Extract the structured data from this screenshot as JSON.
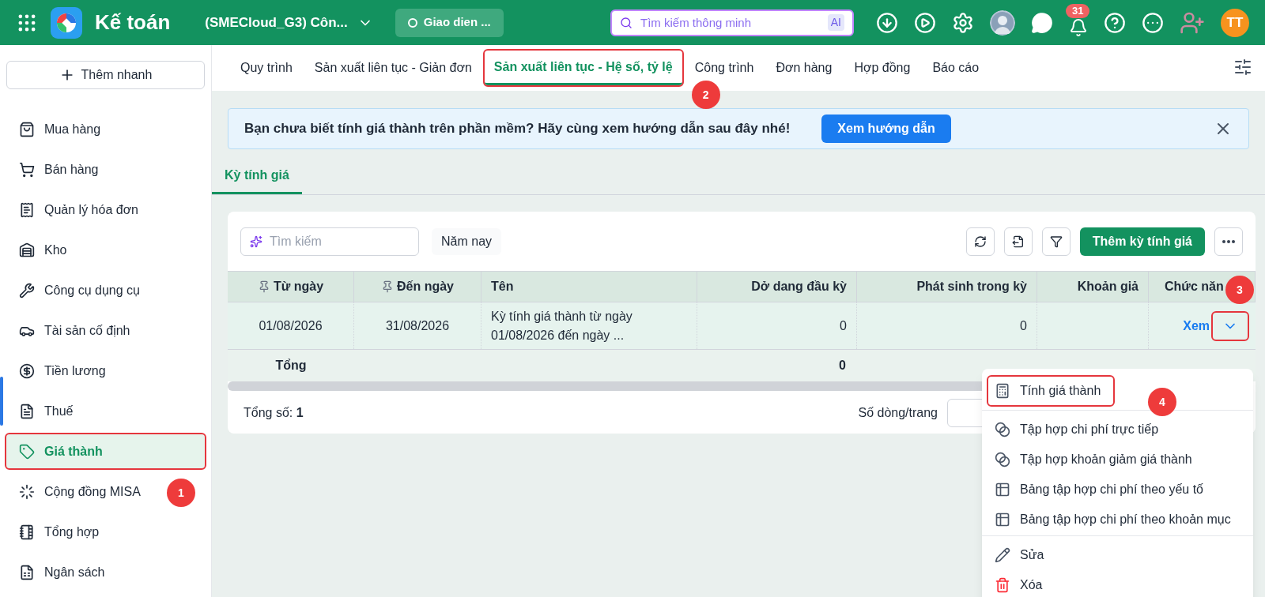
{
  "header": {
    "app_name": "Kế toán",
    "company": "(SMECloud_G3) Côn...",
    "theme_pill": "Giao dien ...",
    "search": {
      "placeholder": "Tìm kiếm thông minh",
      "badge": "AI"
    },
    "notification_count": "31",
    "avatar_initials": "TT"
  },
  "sidebar": {
    "quick_add": "Thêm nhanh",
    "items": [
      {
        "label": "Mua hàng",
        "selected": false,
        "highlighted": false
      },
      {
        "label": "Bán hàng",
        "selected": false,
        "highlighted": false
      },
      {
        "label": "Quản lý hóa đơn",
        "selected": false,
        "highlighted": false
      },
      {
        "label": "Kho",
        "selected": false,
        "highlighted": false
      },
      {
        "label": "Công cụ dụng cụ",
        "selected": false,
        "highlighted": false
      },
      {
        "label": "Tài sản cố định",
        "selected": false,
        "highlighted": false
      },
      {
        "label": "Tiền lương",
        "selected": false,
        "highlighted": false
      },
      {
        "label": "Thuế",
        "selected": false,
        "highlighted": false
      },
      {
        "label": "Giá thành",
        "selected": true,
        "highlighted": true,
        "callout": "1"
      },
      {
        "label": "Cộng đồng MISA",
        "selected": false,
        "highlighted": false
      },
      {
        "label": "Tổng hợp",
        "selected": false,
        "highlighted": false
      },
      {
        "label": "Ngân sách",
        "selected": false,
        "highlighted": false
      }
    ]
  },
  "tabs": [
    {
      "label": "Quy trình",
      "selected": false,
      "highlighted": false
    },
    {
      "label": "Sản xuất liên tục - Giản đơn",
      "selected": false,
      "highlighted": false
    },
    {
      "label": "Sản xuất liên tục - Hệ số, tỷ lệ",
      "selected": true,
      "highlighted": true,
      "callout": "2"
    },
    {
      "label": "Công trình",
      "selected": false,
      "highlighted": false
    },
    {
      "label": "Đơn hàng",
      "selected": false,
      "highlighted": false
    },
    {
      "label": "Hợp đồng",
      "selected": false,
      "highlighted": false
    },
    {
      "label": "Báo cáo",
      "selected": false,
      "highlighted": false
    }
  ],
  "banner": {
    "text": "Bạn chưa biết tính giá thành trên phần mềm? Hãy cùng xem hướng dẫn sau đây nhé!",
    "button": "Xem hướng dẫn"
  },
  "sub_tabs": [
    {
      "label": "Kỳ tính giá",
      "selected": true
    }
  ],
  "toolbar": {
    "search_placeholder": "Tìm kiếm",
    "period": "Năm nay",
    "add_button": "Thêm kỳ tính giá"
  },
  "table": {
    "columns": [
      {
        "label": "Từ ngày",
        "pinned": true
      },
      {
        "label": "Đến ngày",
        "pinned": true
      },
      {
        "label": "Tên",
        "pinned": false
      },
      {
        "label": "Dở dang đầu kỳ",
        "pinned": false
      },
      {
        "label": "Phát sinh trong kỳ",
        "pinned": false
      },
      {
        "label": "Khoản giả",
        "pinned": false
      },
      {
        "label": "Chức năn",
        "pinned": false
      }
    ],
    "rows": [
      {
        "cells": [
          "01/08/2026",
          "31/08/2026",
          "Kỳ tính giá thành từ ngày 01/08/2026 đến ngày ...",
          "0",
          "0",
          ""
        ],
        "action": "Xem",
        "toggle_highlighted": true,
        "toggle_callout": "3"
      }
    ],
    "total": {
      "label": "Tổng",
      "values": [
        "0"
      ]
    },
    "count_text": "Tổng số: **1**",
    "page_size_label": "Số dòng/trang"
  },
  "menu": {
    "groups": [
      [
        {
          "kind": "calculate",
          "label": "Tính giá thành",
          "highlighted": true,
          "callout": "4"
        }
      ],
      [
        {
          "kind": "group",
          "label": "Tập hợp chi phí trực tiếp",
          "highlighted": false
        },
        {
          "kind": "group",
          "label": "Tập hợp khoản giảm giá thành",
          "highlighted": false
        },
        {
          "kind": "table",
          "label": "Bảng tập hợp chi phí theo yếu tố",
          "highlighted": false
        },
        {
          "kind": "table",
          "label": "Bảng tập hợp chi phí theo khoản mục",
          "highlighted": false
        }
      ],
      [
        {
          "kind": "edit",
          "label": "Sửa",
          "highlighted": false
        },
        {
          "kind": "delete",
          "label": "Xóa",
          "highlighted": false
        }
      ]
    ]
  }
}
